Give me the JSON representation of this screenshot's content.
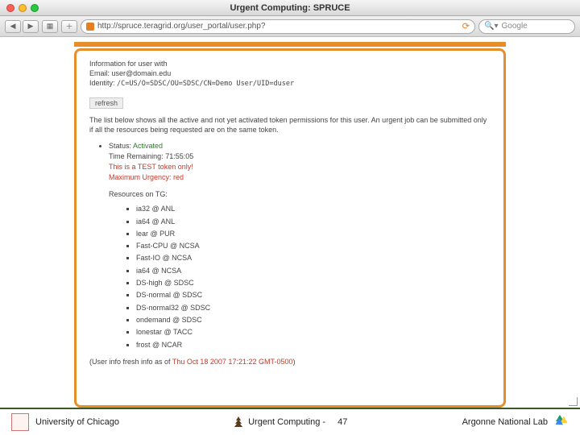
{
  "window": {
    "title": "Urgent Computing: SPRUCE"
  },
  "browser": {
    "url": "http://spruce.teragrid.org/user_portal/user.php?",
    "search_placeholder": "Google"
  },
  "portal": {
    "info_heading": "Information for user with",
    "email_label": "Email:",
    "email": "user@domain.edu",
    "identity_label": "Identity:",
    "identity": "/C=US/O=SDSC/OU=SDSC/CN=Demo User/UID=duser",
    "refresh_label": "refresh",
    "description": "The list below shows all the active and not yet activated token permissions for this user. An urgent job can be submitted only if all the resources being requested are on the same token.",
    "status_label": "Status:",
    "status_value": "Activated",
    "time_label": "Time Remaining:",
    "time_value": "71:55:05",
    "test_notice": "This is a TEST token only!",
    "urgency_label": "Maximum Urgency:",
    "urgency_value": "red",
    "resources_label": "Resources on TG:",
    "resources": [
      "ia32 @ ANL",
      "ia64 @ ANL",
      "lear @ PUR",
      "Fast-CPU @ NCSA",
      "Fast-IO @ NCSA",
      "ia64 @ NCSA",
      "DS-high @ SDSC",
      "DS-normal @ SDSC",
      "DS-normal32 @ SDSC",
      "ondemand @ SDSC",
      "lonestar @ TACC",
      "frost @ NCAR"
    ],
    "fresh_label": "(User info fresh info as of",
    "fresh_ts": "Thu Oct 18 2007 17:21:22 GMT-0500",
    "fresh_close": ")"
  },
  "slide": {
    "left": "University of Chicago",
    "center": "Urgent Computing -",
    "page": "47",
    "right": "Argonne National Lab"
  }
}
